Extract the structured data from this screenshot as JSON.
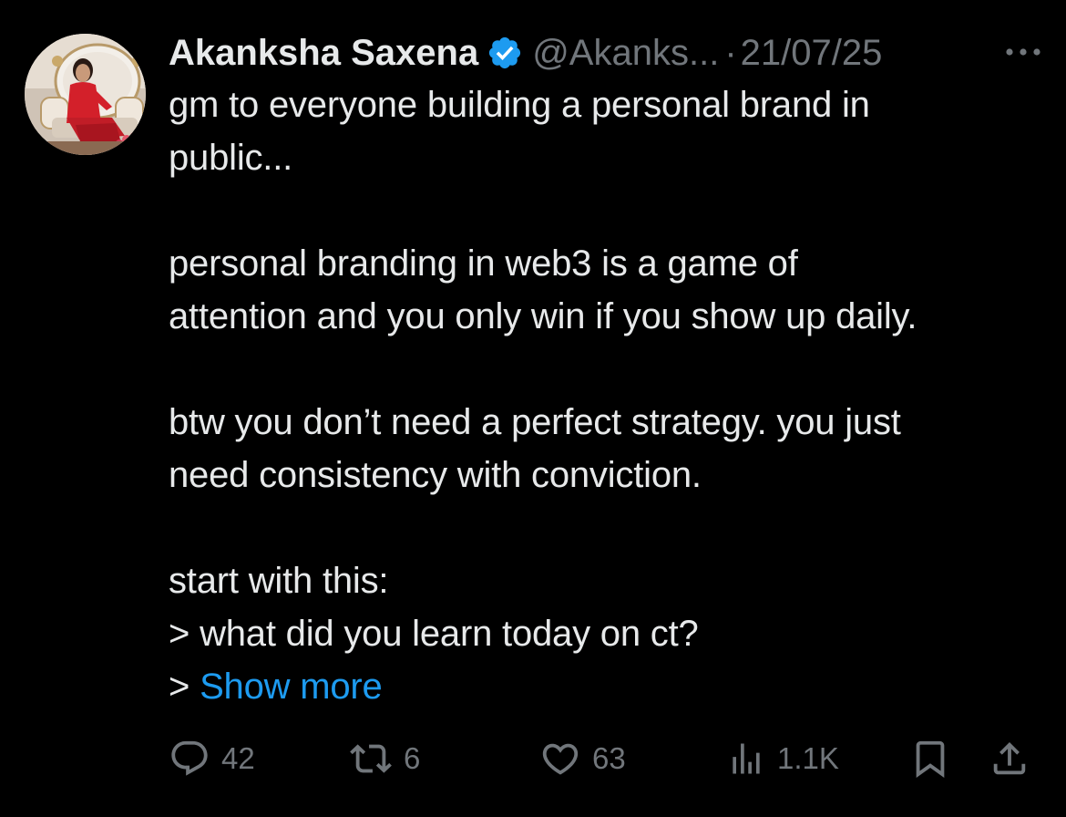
{
  "post": {
    "author": {
      "display_name": "Akanksha Saxena",
      "handle": "@Akanks...",
      "verified": true,
      "avatar_icon": "profile-photo"
    },
    "separator": "·",
    "date": "21/07/25",
    "more_icon": "ellipsis-icon",
    "text_lines": [
      "gm to everyone building a personal brand in",
      "public...",
      "",
      "personal branding in web3 is a game of",
      "attention and you only win if you show up daily.",
      "",
      "btw you don’t need a perfect strategy. you just",
      "need consistency with conviction.",
      "",
      "start with this:",
      "> what did you learn today on ct?"
    ],
    "last_line_prefix": "> ",
    "show_more": "Show more",
    "actions": {
      "replies": {
        "icon": "reply-icon",
        "count": "42"
      },
      "reposts": {
        "icon": "repost-icon",
        "count": "6"
      },
      "likes": {
        "icon": "heart-icon",
        "count": "63"
      },
      "views": {
        "icon": "views-chart-icon",
        "count": "1.1K"
      },
      "bookmark": {
        "icon": "bookmark-icon"
      },
      "share": {
        "icon": "share-icon"
      }
    }
  },
  "colors": {
    "background": "#000000",
    "primary_text": "#e7e9ea",
    "secondary_text": "#71767b",
    "link": "#1d9bf0",
    "verified_badge": "#1d9bf0"
  }
}
